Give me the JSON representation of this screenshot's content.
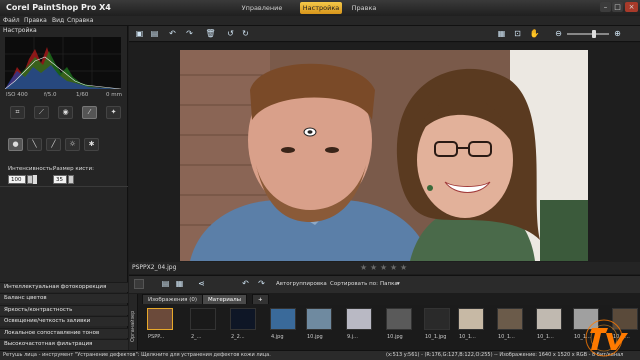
{
  "app": {
    "title": "Corel PaintShop Pro X4"
  },
  "modes": [
    {
      "label": "Управление",
      "active": false
    },
    {
      "label": "Настройка",
      "active": true
    },
    {
      "label": "Правка",
      "active": false
    }
  ],
  "window_buttons": {
    "minimize": "–",
    "maximize": "□",
    "close": "×"
  },
  "menu": [
    "Файл",
    "Правка",
    "Вид",
    "Справка"
  ],
  "left_panel": {
    "title": "Настройка",
    "exif": [
      "ISO 400",
      "f/5.0",
      "1/60",
      "0 mm"
    ],
    "tool_params": {
      "intensity_label": "Интенсивность:",
      "intensity_value": "100",
      "brush_size_label": "Размер кисти:",
      "brush_size_value": "35"
    },
    "effects": [
      "Интеллектуальная фотокоррекция",
      "Баланс цветов",
      "Яркость/контрастность",
      "Освещение/четкость заливки",
      "Локальное сопоставление тонов",
      "Высокочастотная фильтрация"
    ]
  },
  "file": {
    "name": "PSPPX2_04.jpg",
    "rating_stars": 5
  },
  "organizer": {
    "side_label": "Органайзер",
    "auto_group": "Автогруппировка",
    "sort_label": "Сортировать по:",
    "sort_value": "Папка",
    "tabs": [
      {
        "label": "Изображения (0)",
        "active": false
      },
      {
        "label": "Материалы",
        "active": true
      }
    ],
    "add_tab": "+",
    "thumbnails": [
      {
        "label": "PSPP...",
        "color": "#6b4a3a"
      },
      {
        "label": "2_...",
        "color": "#1a1a1a"
      },
      {
        "label": "2_2...",
        "color": "#0e1626"
      },
      {
        "label": "4.jpg",
        "color": "#3a6a9a"
      },
      {
        "label": "10.jpg",
        "color": "#6f8aa0"
      },
      {
        "label": "9.j...",
        "color": "#b9b9c4"
      },
      {
        "label": "10.jpg",
        "color": "#5a5a5a"
      },
      {
        "label": "10_1.jpg",
        "color": "#2a2a2a"
      },
      {
        "label": "10_1...",
        "color": "#c7b9a5"
      },
      {
        "label": "10_1...",
        "color": "#6b5b4a"
      },
      {
        "label": "10_1...",
        "color": "#c0b9b0"
      },
      {
        "label": "10_1...",
        "color": "#a0a0a0"
      },
      {
        "label": "10_1...",
        "color": "#5a4a3a"
      }
    ]
  },
  "status": {
    "left": "Ретушь лица - инструмент \"Устранение дефектов\": Щелкните для устранения дефектов кожи лица.",
    "right": "(x:513 y:561) - (R:176,G:127,B:122,O:255) -- Изображение: 1640 x 1520 x RGB - 8 бит/канал"
  },
  "colors": {
    "accent_tab": "#e8a92a",
    "watermark": "#ff7a00"
  }
}
